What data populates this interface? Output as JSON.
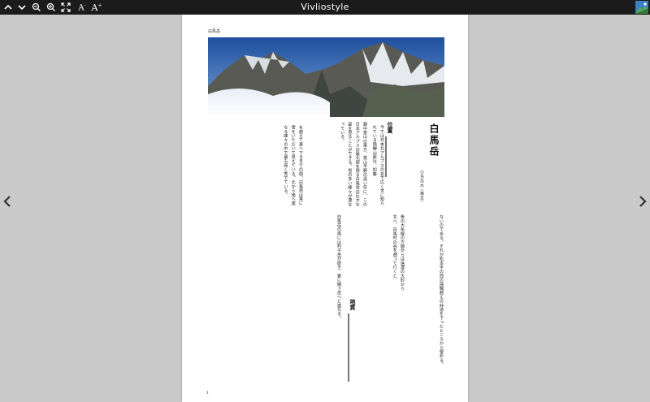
{
  "toolbar": {
    "title": "Vivliostyle",
    "buttons": [
      {
        "name": "page-up",
        "label": "∧"
      },
      {
        "name": "page-down",
        "label": "∨"
      },
      {
        "name": "zoom-out",
        "label": "⊖"
      },
      {
        "name": "zoom-in",
        "label": "⊕"
      },
      {
        "name": "fit",
        "label": "⤢"
      },
      {
        "name": "font-smaller",
        "label": "A⁻"
      },
      {
        "name": "font-larger",
        "label": "A⁺"
      }
    ]
  },
  "page": {
    "header_label": "白馬岳",
    "title": "白馬岳",
    "author": "小島烏水 (推定)",
    "page_number": "1",
    "sections": {
      "position_heading": "位置",
      "geology_heading": "地質"
    },
    "columns": {
      "right_top": "今では日本北アルプスの名で広く世に知られている飛騨山脈は、加藤",
      "right_bottom": "ないのである。それが松本平の西の飛騨越えの峠道を下ったところから望める。",
      "middle_top": "越中富山の東方、富山平野の遠い空に、この日本アルプスの最北部を限る白馬岳の巨大な姿を見ることができる。雪の多い峰々が連なっている。",
      "middle_bottom": "後の大糸線の方面からは信濃の大町から北へ、白馬村の谷を遡って行くと、",
      "left_top": "を越えて東へ下るまでの間、白馬岳は常に雪をいただいて見えている。北から南へ連なる峰々の中で最も高く秀でている。",
      "left_bottom": "白馬岳の南には杓子岳が続き、更に鑓ヶ岳へと連なる。"
    }
  },
  "colors": {
    "toolbar_bg": "#1b1b1b",
    "viewer_bg": "#c9c9c9",
    "page_bg": "#ffffff"
  }
}
